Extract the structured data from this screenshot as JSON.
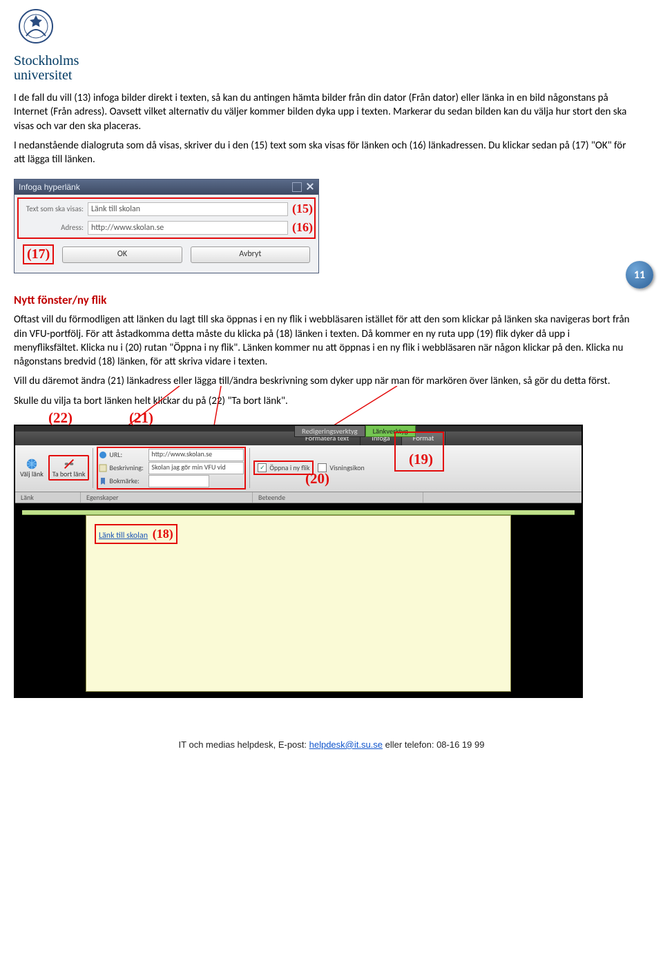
{
  "logo": {
    "line1": "Stockholms",
    "line2": "universitet"
  },
  "page_badge": "11",
  "para1": "I de fall du vill (13) infoga bilder direkt i texten, så kan du antingen hämta bilder från din dator (Från dator) eller länka in en bild någonstans på Internet (Från adress). Oavsett vilket alternativ du väljer kommer bilden dyka upp i texten. Markerar du sedan bilden kan du välja hur stort den ska visas och var den ska placeras.",
  "para2": "I nedanstående dialogruta som då visas, skriver du i den (15) text som ska visas för länken och (16) länkadressen. Du klickar sedan på (17) \"OK\" för att lägga till länken.",
  "dialog": {
    "title": "Infoga hyperlänk",
    "text_label": "Text som ska visas:",
    "text_value": "Länk till skolan",
    "callout15": "(15)",
    "adress_label": "Adress:",
    "adress_value": "http://www.skolan.se",
    "callout16": "(16)",
    "callout17": "(17)",
    "ok": "OK",
    "cancel": "Avbryt"
  },
  "section_heading": "Nytt fönster/ny flik",
  "para3": "Oftast vill du förmodligen att länken du lagt till ska öppnas i en ny flik i webbläsaren istället för att den som klickar på länken ska navigeras bort från din VFU-portfölj. För att åstadkomma detta måste du klicka på (18) länken i texten. Då kommer en ny ruta upp (19) flik dyker då upp i menyfliksfältet. Klicka nu i (20) rutan \"Öppna i ny flik\". Länken kommer nu att öppnas i en ny flik i webbläsaren när någon klickar på den. Klicka nu någonstans bredvid (18) länken, för att skriva vidare i texten.",
  "para4": "Vill du däremot ändra (21) länkadress eller lägga till/ändra beskrivning som dyker upp när man för markören över länken, så gör du detta först.",
  "para5": "Skulle du vilja ta bort länken helt klickar du på (22) \"Ta bort länk\".",
  "editor": {
    "context_tab1": "Redigeringsverktyg",
    "context_tab2": "Länkverktyg",
    "ribbon_tab1": "Formatera text",
    "ribbon_tab2": "Infoga",
    "ribbon_tab3": "Format",
    "callout19": "(19)",
    "callout20": "(20)",
    "callout21": "(21)",
    "callout22": "(22)",
    "choose_link": "Välj länk",
    "remove_link": "Ta bort länk",
    "url_label": "URL:",
    "url_value": "http://www.skolan.se",
    "beskrivning_label": "Beskrivning:",
    "beskrivning_value": "Skolan jag gör min VFU vid",
    "bokmarke_label": "Bokmärke:",
    "open_newtab": "Öppna i ny flik",
    "display_icon": "Visningsikon",
    "grp_lank": "Länk",
    "grp_egenskaper": "Egenskaper",
    "grp_beteende": "Beteende",
    "doc_link_text": "Länk till skolan",
    "callout18": "(18)"
  },
  "footer": {
    "prefix": "IT och medias helpdesk, E-post: ",
    "email": "helpdesk@it.su.se",
    "suffix": " eller telefon: 08-16 19 99"
  }
}
